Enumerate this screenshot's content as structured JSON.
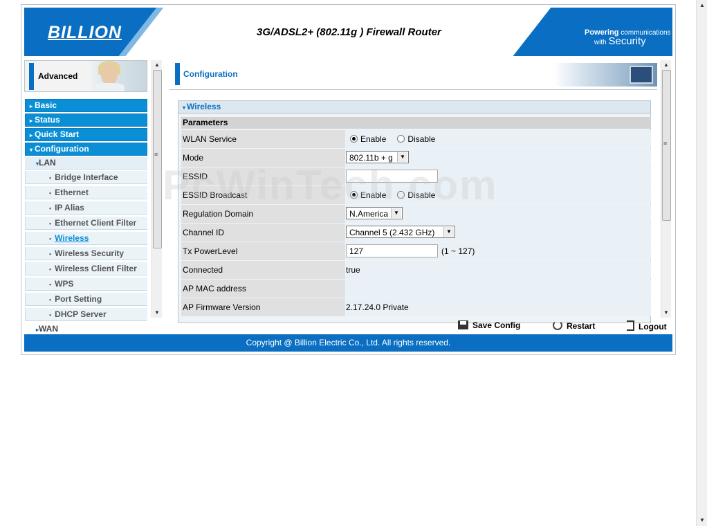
{
  "header": {
    "brand": "BILLION",
    "product_title": "3G/ADSL2+ (802.11g ) Firewall Router",
    "tagline_line1": "Powering",
    "tagline_line1b": "communications",
    "tagline_line2": "with",
    "tagline_line2b": "Security"
  },
  "sidebar": {
    "mode_label": "Advanced",
    "top_items": [
      "Basic",
      "Status",
      "Quick Start",
      "Configuration"
    ],
    "lan_label": "LAN",
    "lan_items": [
      "Bridge Interface",
      "Ethernet",
      "IP Alias",
      "Ethernet Client Filter",
      "Wireless",
      "Wireless Security",
      "Wireless Client Filter",
      "WPS",
      "Port Setting",
      "DHCP Server"
    ],
    "wan_label": "WAN",
    "active_item": "Wireless"
  },
  "content": {
    "section_title": "Configuration",
    "panel_title": "Wireless",
    "params_title": "Parameters",
    "rows": {
      "wlan_service": {
        "label": "WLAN Service",
        "enable": "Enable",
        "disable": "Disable"
      },
      "mode": {
        "label": "Mode",
        "value": "802.11b + g"
      },
      "essid": {
        "label": "ESSID",
        "value": ""
      },
      "essid_broadcast": {
        "label": "ESSID Broadcast",
        "enable": "Enable",
        "disable": "Disable"
      },
      "regulation": {
        "label": "Regulation Domain",
        "value": "N.America"
      },
      "channel": {
        "label": "Channel ID",
        "value": "Channel 5 (2.432 GHz)"
      },
      "tx_power": {
        "label": "Tx PowerLevel",
        "value": "127",
        "hint": "(1 ~ 127)"
      },
      "connected": {
        "label": "Connected",
        "value": "true"
      },
      "ap_mac": {
        "label": "AP MAC address",
        "value": ""
      },
      "ap_firmware": {
        "label": "AP Firmware Version",
        "value": "2.17.24.0 Private"
      }
    }
  },
  "toolbar": {
    "save": "Save Config",
    "restart": "Restart",
    "logout": "Logout"
  },
  "footer": {
    "copyright": "Copyright @ Billion Electric Co., Ltd. All rights reserved."
  },
  "watermark": "PcWinTech.com",
  "colors": {
    "brand_blue": "#0a6fc2",
    "menu_blue": "#0a8fd6"
  }
}
